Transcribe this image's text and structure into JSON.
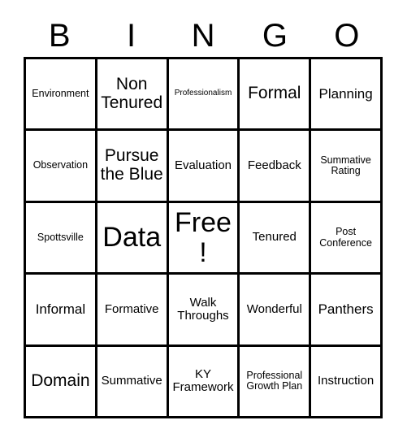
{
  "card": {
    "title_letters": [
      "B",
      "I",
      "N",
      "G",
      "O"
    ],
    "free_space_label": "Free!",
    "colors": {
      "border": "#000000",
      "background": "#ffffff",
      "text": "#000000"
    },
    "rows": [
      [
        {
          "label": "Environment",
          "size": "sm"
        },
        {
          "label": "Non Tenured",
          "size": "xl"
        },
        {
          "label": "Professionalism",
          "size": "xs"
        },
        {
          "label": "Formal",
          "size": "xl"
        },
        {
          "label": "Planning",
          "size": "lg"
        }
      ],
      [
        {
          "label": "Observation",
          "size": "sm"
        },
        {
          "label": "Pursue the Blue",
          "size": "xl"
        },
        {
          "label": "Evaluation",
          "size": "md"
        },
        {
          "label": "Feedback",
          "size": "md"
        },
        {
          "label": "Summative Rating",
          "size": "sm"
        }
      ],
      [
        {
          "label": "Spottsville",
          "size": "sm"
        },
        {
          "label": "Data",
          "size": "xxl"
        },
        {
          "label": "Free!",
          "size": "xxl"
        },
        {
          "label": "Tenured",
          "size": "md"
        },
        {
          "label": "Post Conference",
          "size": "sm"
        }
      ],
      [
        {
          "label": "Informal",
          "size": "lg"
        },
        {
          "label": "Formative",
          "size": "md"
        },
        {
          "label": "Walk Throughs",
          "size": "md"
        },
        {
          "label": "Wonderful",
          "size": "md"
        },
        {
          "label": "Panthers",
          "size": "lg"
        }
      ],
      [
        {
          "label": "Domain",
          "size": "xl"
        },
        {
          "label": "Summative",
          "size": "md"
        },
        {
          "label": "KY Framework",
          "size": "md"
        },
        {
          "label": "Professional Growth Plan",
          "size": "sm"
        },
        {
          "label": "Instruction",
          "size": "md"
        }
      ]
    ]
  }
}
